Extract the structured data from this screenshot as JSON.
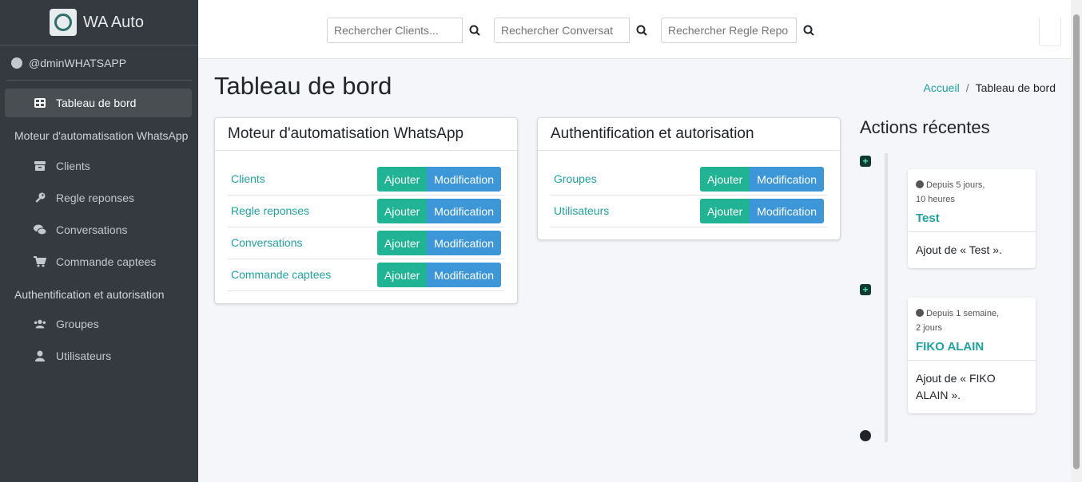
{
  "brand": {
    "name": "WA Auto"
  },
  "user": {
    "name": "@dminWHATSAPP"
  },
  "sidebar": {
    "dashboard": "Tableau de bord",
    "section1": "Moteur d'automatisation WhatsApp",
    "section1_items": [
      "Clients",
      "Regle reponses",
      "Conversations",
      "Commande captees"
    ],
    "section2": "Authentification et autorisation",
    "section2_items": [
      "Groupes",
      "Utilisateurs"
    ]
  },
  "search": {
    "clients_placeholder": "Rechercher Clients...",
    "conversations_placeholder": "Rechercher Conversat",
    "regles_placeholder": "Rechercher Regle Repo"
  },
  "page": {
    "title": "Tableau de bord"
  },
  "breadcrumb": {
    "home": "Accueil",
    "sep": "/",
    "current": "Tableau de bord"
  },
  "card1": {
    "title": "Moteur d'automatisation WhatsApp",
    "rows": [
      "Clients",
      "Regle reponses",
      "Conversations",
      "Commande captees"
    ]
  },
  "card2": {
    "title": "Authentification et autorisation",
    "rows": [
      "Groupes",
      "Utilisateurs"
    ]
  },
  "buttons": {
    "add": "Ajouter",
    "edit": "Modification"
  },
  "recent": {
    "title": "Actions récentes",
    "items": [
      {
        "time_line1": "Depuis 5 jours,",
        "time_line2": "10 heures",
        "name": "Test",
        "body": "Ajout de « Test »."
      },
      {
        "time_line1": "Depuis 1 semaine,",
        "time_line2": "2 jours",
        "name": "FIKO ALAIN",
        "body_line1": "Ajout de « FIKO",
        "body_line2": "ALAIN »."
      }
    ]
  },
  "colors": {
    "sidebar": "#343a40",
    "teal": "#20b394",
    "blue": "#3c96d8",
    "link": "#20a39e"
  }
}
